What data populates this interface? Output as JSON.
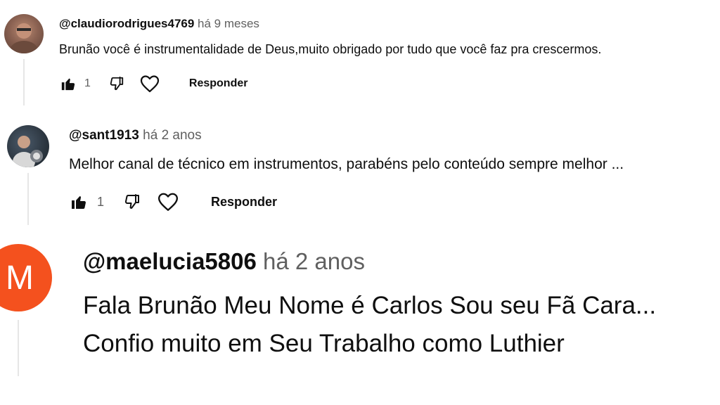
{
  "comments": [
    {
      "handle": "@claudiorodrigues4769",
      "time": "há 9 meses",
      "text": "Brunão você é instrumentalidade de Deus,muito obrigado por tudo que você faz pra crescermos.",
      "likes": "1",
      "reply_label": "Responder",
      "avatar_type": "photo"
    },
    {
      "handle": "@sant1913",
      "time": "há 2 anos",
      "text": "Melhor canal de técnico em instrumentos, parabéns pelo conteúdo sempre melhor ...",
      "likes": "1",
      "reply_label": "Responder",
      "avatar_type": "photo"
    },
    {
      "handle": "@maelucia5806",
      "time": "há 2 anos",
      "text_line1": "Fala Brunão  Meu Nome é Carlos Sou seu Fã Cara...",
      "text_line2": "Confio muito em Seu Trabalho como Luthier",
      "avatar_letter": "M",
      "avatar_color": "#f4511e"
    }
  ],
  "icons": {
    "like": "thumbs-up-icon",
    "dislike": "thumbs-down-icon",
    "heart": "heart-icon"
  }
}
